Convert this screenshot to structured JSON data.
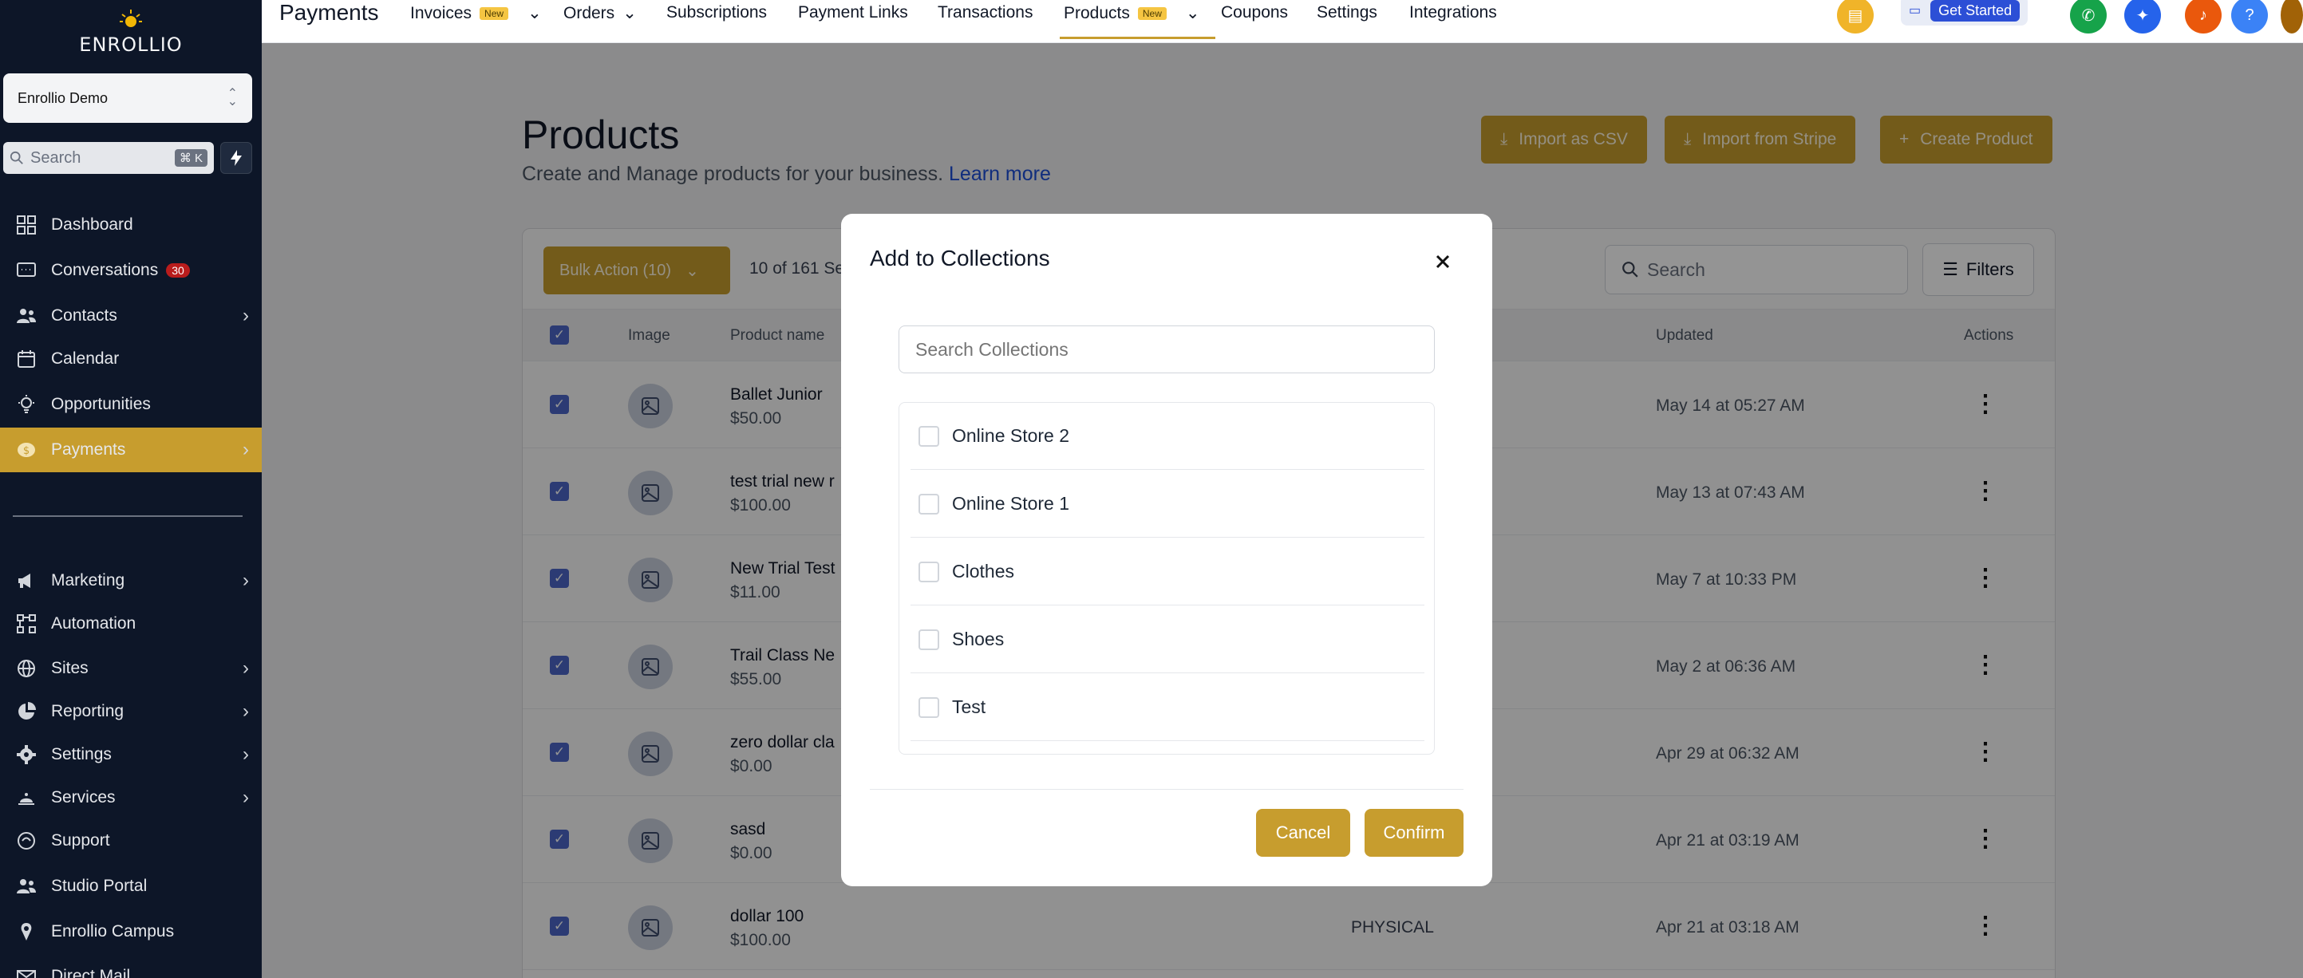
{
  "app": {
    "brand": "ENROLLIO",
    "account": "Enrollio Demo",
    "search_placeholder": "Search",
    "search_shortcut": "⌘ K"
  },
  "sidebar": {
    "items": [
      {
        "label": "Dashboard",
        "icon": "dashboard-icon"
      },
      {
        "label": "Conversations",
        "icon": "chat-icon",
        "badge": "30"
      },
      {
        "label": "Contacts",
        "icon": "contacts-icon"
      },
      {
        "label": "Calendar",
        "icon": "calendar-icon"
      },
      {
        "label": "Opportunities",
        "icon": "lightbulb-icon"
      },
      {
        "label": "Payments",
        "icon": "payments-icon"
      },
      {
        "label": "Marketing",
        "icon": "megaphone-icon"
      },
      {
        "label": "Automation",
        "icon": "automation-icon"
      },
      {
        "label": "Sites",
        "icon": "globe-icon"
      },
      {
        "label": "Reporting",
        "icon": "pie-chart-icon"
      },
      {
        "label": "Settings",
        "icon": "gear-icon"
      },
      {
        "label": "Services",
        "icon": "services-icon"
      },
      {
        "label": "Support",
        "icon": "support-icon"
      },
      {
        "label": "Studio Portal",
        "icon": "users-icon"
      },
      {
        "label": "Enrollio Campus",
        "icon": "campus-icon"
      },
      {
        "label": "Direct Mail",
        "icon": "mail-icon"
      }
    ]
  },
  "topbar": {
    "section": "Payments",
    "tabs": [
      {
        "label": "Invoices",
        "new": "New"
      },
      {
        "label": "Orders"
      },
      {
        "label": "Subscriptions"
      },
      {
        "label": "Payment Links"
      },
      {
        "label": "Transactions"
      },
      {
        "label": "Products",
        "new": "New"
      },
      {
        "label": "Coupons"
      },
      {
        "label": "Settings"
      },
      {
        "label": "Integrations"
      }
    ],
    "get_started": "Get Started"
  },
  "page": {
    "title": "Products",
    "subtitle": "Create and Manage products for your business.",
    "learn_more": "Learn more",
    "buttons": {
      "import_csv": "Import as CSV",
      "import_stripe": "Import from Stripe",
      "create": "Create Product"
    }
  },
  "table": {
    "bulk_action": "Bulk Action (10)",
    "selection": "10 of 161 Se",
    "search_placeholder": "Search",
    "filters": "Filters",
    "columns": {
      "image": "Image",
      "name": "Product name",
      "updated": "Updated",
      "actions": "Actions"
    },
    "rows": [
      {
        "name": "Ballet Junior",
        "price": "$50.00",
        "type": "",
        "updated": "May 14 at 05:27 AM"
      },
      {
        "name": "test trial new r",
        "price": "$100.00",
        "type": "",
        "updated": "May 13 at 07:43 AM"
      },
      {
        "name": "New Trial Test",
        "price": "$11.00",
        "type": "",
        "updated": "May 7 at 10:33 PM"
      },
      {
        "name": "Trail Class Ne",
        "price": "$55.00",
        "type": "",
        "updated": "May 2 at 06:36 AM"
      },
      {
        "name": "zero dollar cla",
        "price": "$0.00",
        "type": "",
        "updated": "Apr 29 at 06:32 AM"
      },
      {
        "name": "sasd",
        "price": "$0.00",
        "type": "",
        "updated": "Apr 21 at 03:19 AM"
      },
      {
        "name": "dollar 100",
        "price": "$100.00",
        "type": "PHYSICAL",
        "updated": "Apr 21 at 03:18 AM"
      }
    ]
  },
  "modal": {
    "title": "Add to Collections",
    "search_placeholder": "Search Collections",
    "collections": [
      "Online Store 2",
      "Online Store 1",
      "Clothes",
      "Shoes",
      "Test"
    ],
    "cancel": "Cancel",
    "confirm": "Confirm"
  },
  "colors": {
    "accent": "#c79d2e",
    "sidebar_bg": "#0d1628",
    "checkbox_checked": "#4c66c8",
    "link": "#1d4ed8"
  }
}
